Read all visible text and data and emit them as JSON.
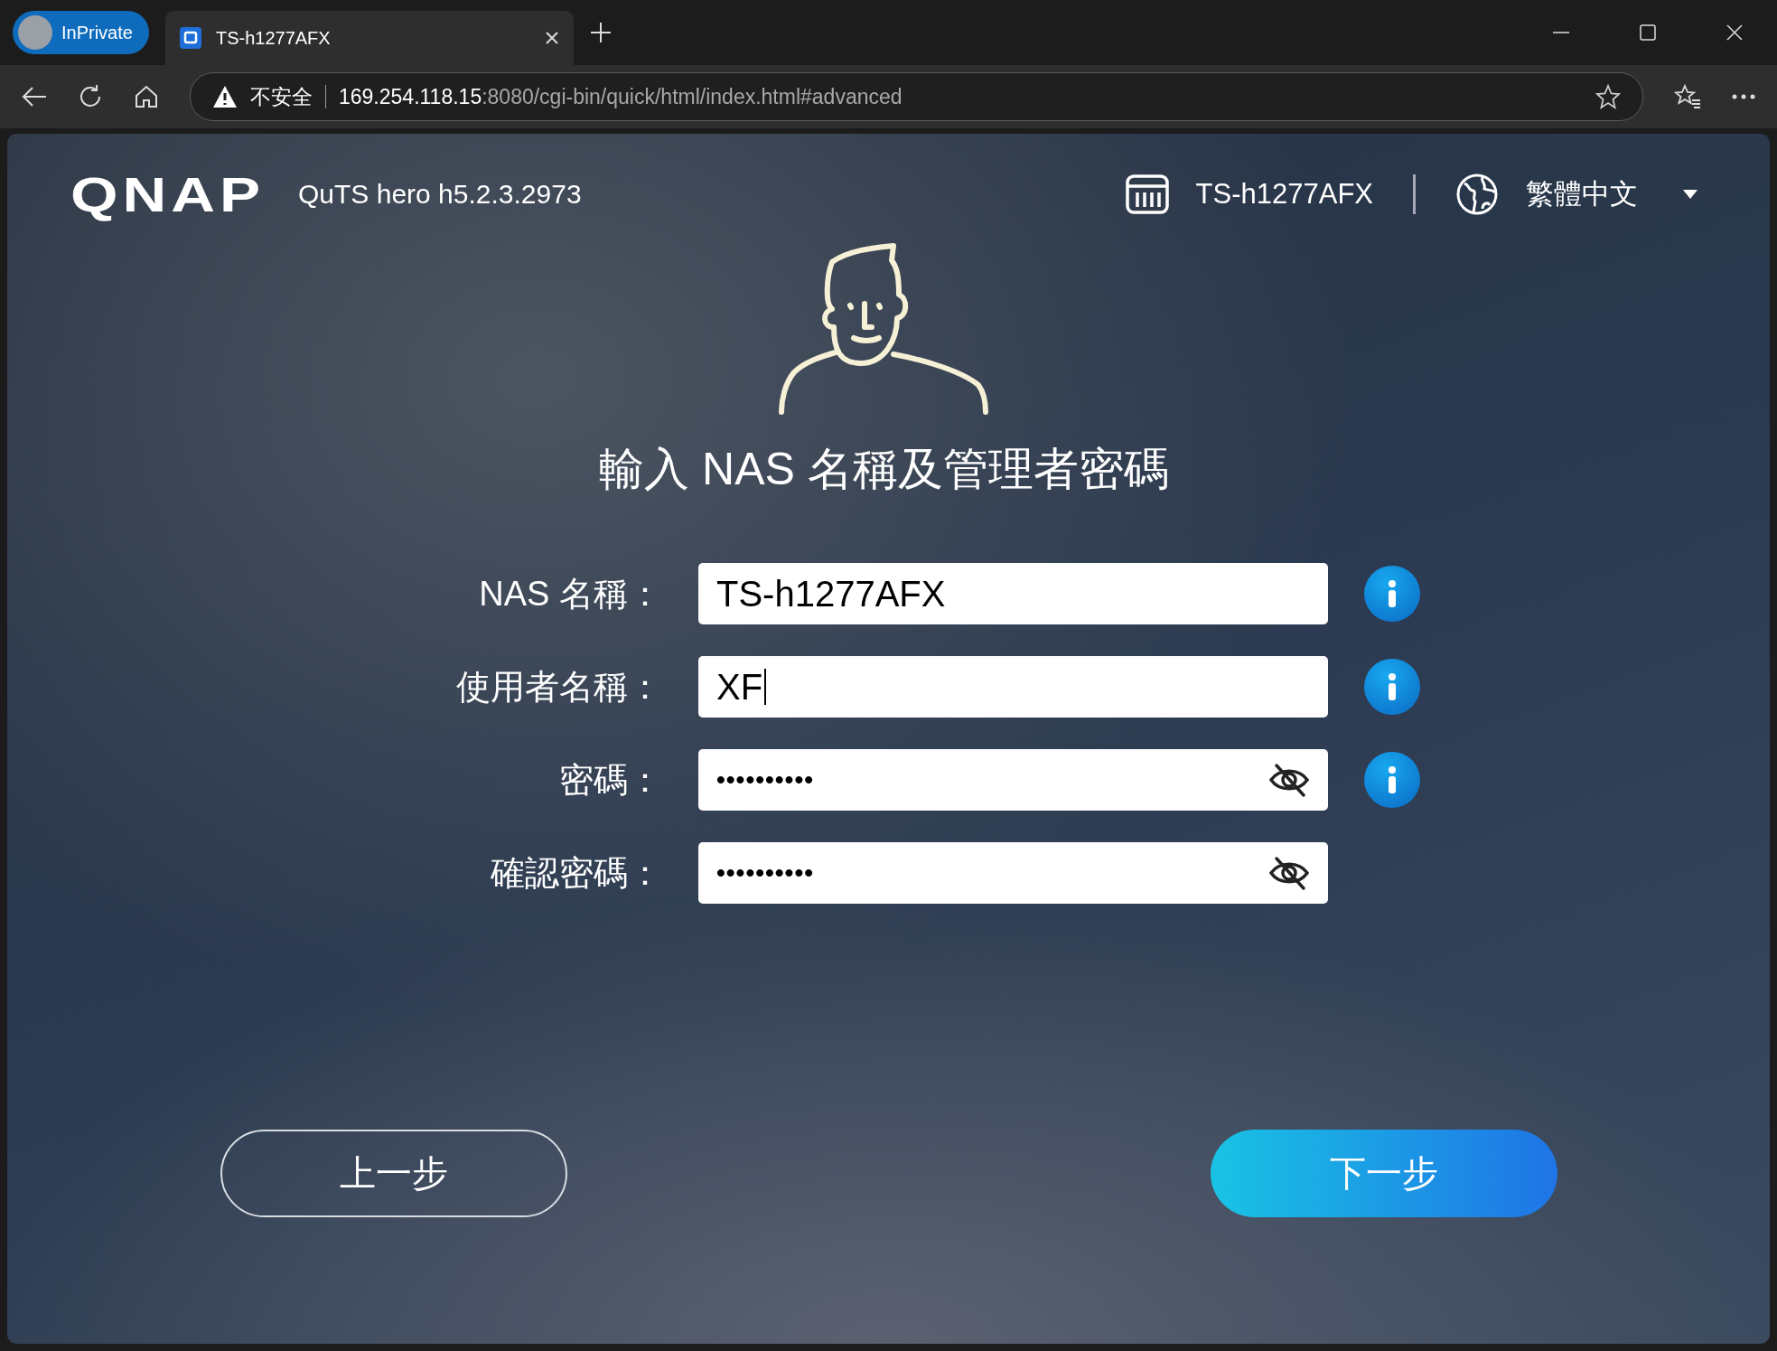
{
  "browser": {
    "profile": "InPrivate",
    "tab": {
      "title": "TS-h1277AFX",
      "selected": true
    },
    "security": "不安全",
    "url_host": "169.254.118.15",
    "url_rest": ":8080/cgi-bin/quick/html/index.html#advanced"
  },
  "header": {
    "logo": "QNAP",
    "version": "QuTS hero h5.2.3.2973",
    "device": "TS-h1277AFX",
    "language": "繁體中文"
  },
  "title": "輸入 NAS 名稱及管理者密碼",
  "fields": [
    {
      "label": "NAS 名稱：",
      "value": "TS-h1277AFX",
      "focused": false,
      "masked": false,
      "info": true
    },
    {
      "label": "使用者名稱：",
      "value": "XF",
      "focused": true,
      "masked": false,
      "info": true
    },
    {
      "label": "密碼：",
      "value": "••••••••••",
      "focused": false,
      "masked": true,
      "info": true
    },
    {
      "label": "確認密碼：",
      "value": "••••••••••",
      "focused": false,
      "masked": true,
      "info": false
    }
  ],
  "buttons": [
    {
      "label": "上一步",
      "kind": "secondary"
    },
    {
      "label": "下一步",
      "kind": "primary"
    }
  ]
}
